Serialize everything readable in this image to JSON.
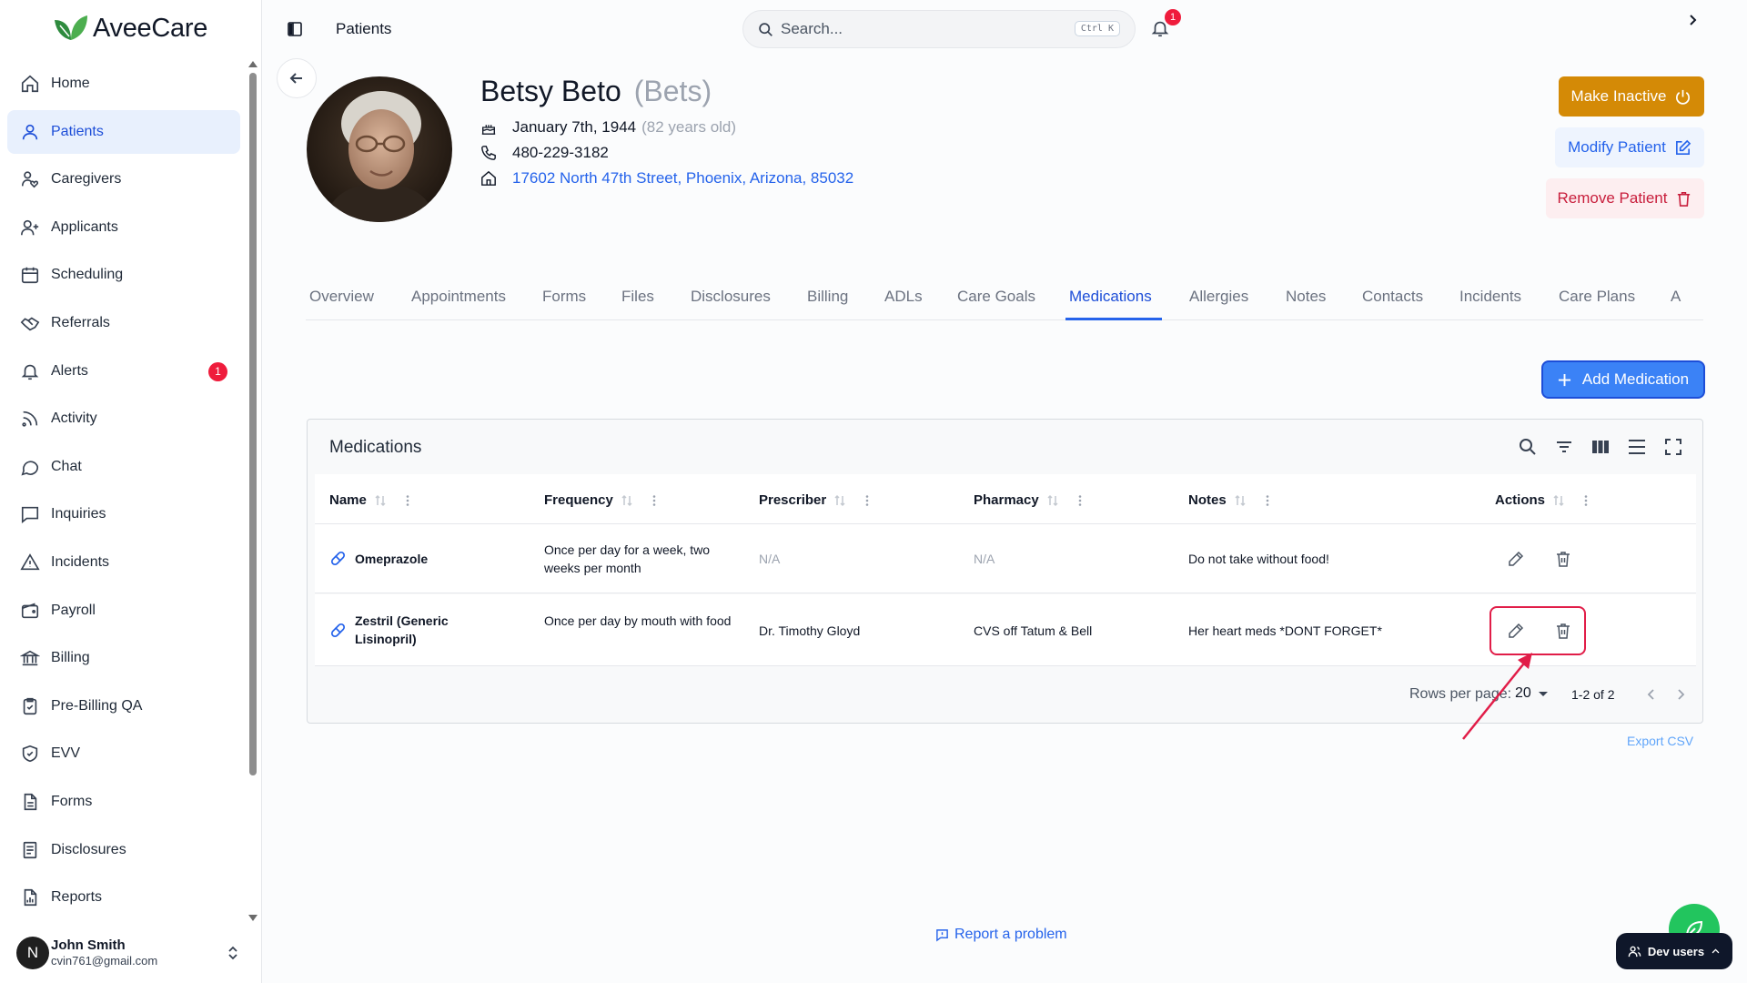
{
  "app": {
    "brand": "AveeCare"
  },
  "sidebar": {
    "items": [
      {
        "label": "Home",
        "icon": "home-icon"
      },
      {
        "label": "Patients",
        "icon": "user-icon",
        "active": true
      },
      {
        "label": "Caregivers",
        "icon": "caregivers-icon"
      },
      {
        "label": "Applicants",
        "icon": "user-plus-icon"
      },
      {
        "label": "Scheduling",
        "icon": "calendar-icon"
      },
      {
        "label": "Referrals",
        "icon": "handshake-icon"
      },
      {
        "label": "Alerts",
        "icon": "bell-icon",
        "badge": "1"
      },
      {
        "label": "Activity",
        "icon": "rss-icon"
      },
      {
        "label": "Chat",
        "icon": "chat-icon"
      },
      {
        "label": "Inquiries",
        "icon": "message-square-icon"
      },
      {
        "label": "Incidents",
        "icon": "warning-icon"
      },
      {
        "label": "Payroll",
        "icon": "wallet-icon"
      },
      {
        "label": "Billing",
        "icon": "bank-icon"
      },
      {
        "label": "Pre-Billing QA",
        "icon": "clipboard-check-icon"
      },
      {
        "label": "EVV",
        "icon": "shield-check-icon"
      },
      {
        "label": "Forms",
        "icon": "file-text-icon"
      },
      {
        "label": "Disclosures",
        "icon": "file-list-icon"
      },
      {
        "label": "Reports",
        "icon": "report-icon"
      }
    ],
    "user": {
      "initial": "N",
      "name": "John Smith",
      "email": "cvin761@gmail.com"
    }
  },
  "topbar": {
    "title": "Patients",
    "search_placeholder": "Search...",
    "search_shortcut": "Ctrl K",
    "notifications_count": "1"
  },
  "patient": {
    "name": "Betsy Beto",
    "nickname": "(Bets)",
    "dob": "January 7th, 1944",
    "age": "(82 years old)",
    "phone": "480-229-3182",
    "address": "17602 North 47th Street, Phoenix, Arizona, 85032"
  },
  "actions": {
    "make_inactive": "Make Inactive",
    "modify": "Modify Patient",
    "remove": "Remove Patient"
  },
  "tabs": [
    {
      "label": "Overview"
    },
    {
      "label": "Appointments"
    },
    {
      "label": "Forms"
    },
    {
      "label": "Files"
    },
    {
      "label": "Disclosures"
    },
    {
      "label": "Billing"
    },
    {
      "label": "ADLs"
    },
    {
      "label": "Care Goals"
    },
    {
      "label": "Medications",
      "active": true
    },
    {
      "label": "Allergies"
    },
    {
      "label": "Notes"
    },
    {
      "label": "Contacts"
    },
    {
      "label": "Incidents"
    },
    {
      "label": "Care Plans"
    },
    {
      "label": "A"
    }
  ],
  "add_medication": "Add Medication",
  "medications": {
    "title": "Medications",
    "columns": [
      "Name",
      "Frequency",
      "Prescriber",
      "Pharmacy",
      "Notes",
      "Actions"
    ],
    "rows": [
      {
        "name": "Omeprazole",
        "frequency": "Once per day for a week, two weeks per month",
        "prescriber": "N/A",
        "pharmacy": "N/A",
        "notes": "Do not take without food!"
      },
      {
        "name": "Zestril (Generic Lisinopril)",
        "frequency": "Once per day by mouth with food",
        "prescriber": "Dr. Timothy Gloyd",
        "pharmacy": "CVS off Tatum & Bell",
        "notes": "Her heart meds *DONT FORGET*"
      }
    ],
    "rows_per_page_label": "Rows per page:",
    "rows_per_page": "20",
    "page_range": "1-2 of 2",
    "export": "Export CSV"
  },
  "report_problem": "Report a problem",
  "dev_users": "Dev users",
  "colors": {
    "primary": "#2563eb",
    "active_nav_bg": "#e8f0fd",
    "inactive_btn": "#d48a06",
    "danger": "#c81e3c",
    "badge": "#ef1c3c",
    "annotation": "#e11d48",
    "fab": "#22c55e"
  }
}
